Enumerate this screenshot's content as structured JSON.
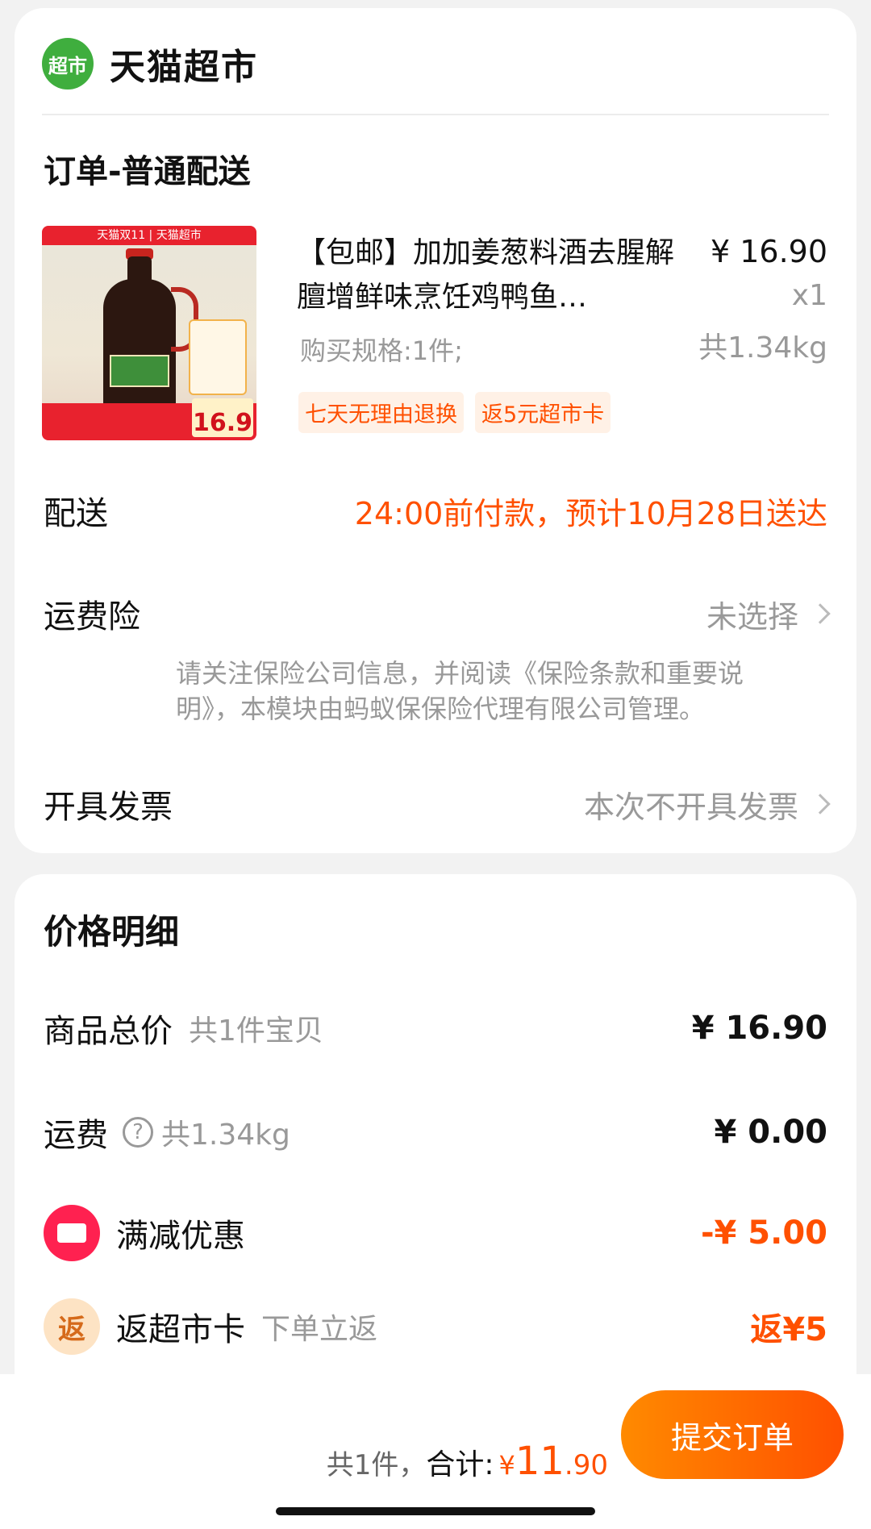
{
  "store": {
    "logo_text": "超市",
    "name": "天猫超市"
  },
  "order": {
    "type_title": "订单-普通配送"
  },
  "product": {
    "image_top_banner": "天猫双11 | 天猫超市",
    "image_price": "16.9",
    "title": "【包邮】加加姜葱料酒去腥解膻增鲜味烹饪鸡鸭鱼…",
    "spec": "购买规格:1件;",
    "price": "¥ 16.90",
    "qty": "x1",
    "weight": "共1.34kg",
    "tags": [
      "七天无理由退换",
      "返5元超市卡"
    ]
  },
  "delivery": {
    "label": "配送",
    "value": "24:00前付款，预计10月28日送达"
  },
  "insurance": {
    "label": "运费险",
    "value": "未选择",
    "note": "请关注保险公司信息，并阅读《保险条款和重要说明》，本模块由蚂蚁保保险代理有限公司管理。"
  },
  "invoice": {
    "label": "开具发票",
    "value": "本次不开具发票"
  },
  "price_detail": {
    "title": "价格明细",
    "goods_total": {
      "label": "商品总价",
      "sub": "共1件宝贝",
      "value": "¥ 16.90"
    },
    "shipping": {
      "label": "运费",
      "help_icon": "?",
      "sub": "共1.34kg",
      "value": "¥ 0.00"
    },
    "discount": {
      "label": "满减优惠",
      "value": "-¥ 5.00"
    },
    "return_card": {
      "icon_text": "返",
      "label": "返超市卡",
      "sub": "下单立返",
      "value": "返¥5"
    }
  },
  "footer": {
    "count": "共1件，",
    "total_label": "合计:",
    "yen": "¥",
    "total_int": "11",
    "total_dec": ".90",
    "submit_label": "提交订单"
  },
  "colors": {
    "accent": "#ff5000",
    "store_green": "#3fae3e",
    "coupon_red": "#ff2150"
  }
}
